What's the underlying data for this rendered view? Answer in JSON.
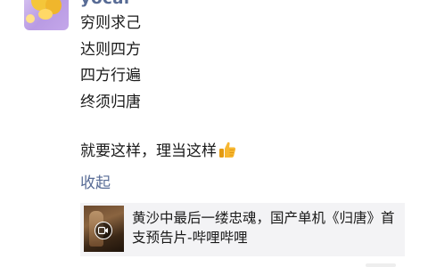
{
  "post": {
    "author": "yocal",
    "lines": [
      "穷则求己",
      "达则四方",
      "四方行遍",
      "终须归唐"
    ],
    "closing": "就要这样，理当这样",
    "closing_emoji": "thumbs-up-icon",
    "collapse_label": "收起"
  },
  "link_card": {
    "title": "黄沙中最后一缕忠魂，国产单机《归唐》首支预告片-哔哩哔哩",
    "thumbnail_icon": "video-play-icon"
  },
  "colors": {
    "link_blue": "#576b95",
    "text": "#1a1a1a",
    "card_bg": "#f3f3f5",
    "thumb_yellow": "#f7b731"
  }
}
